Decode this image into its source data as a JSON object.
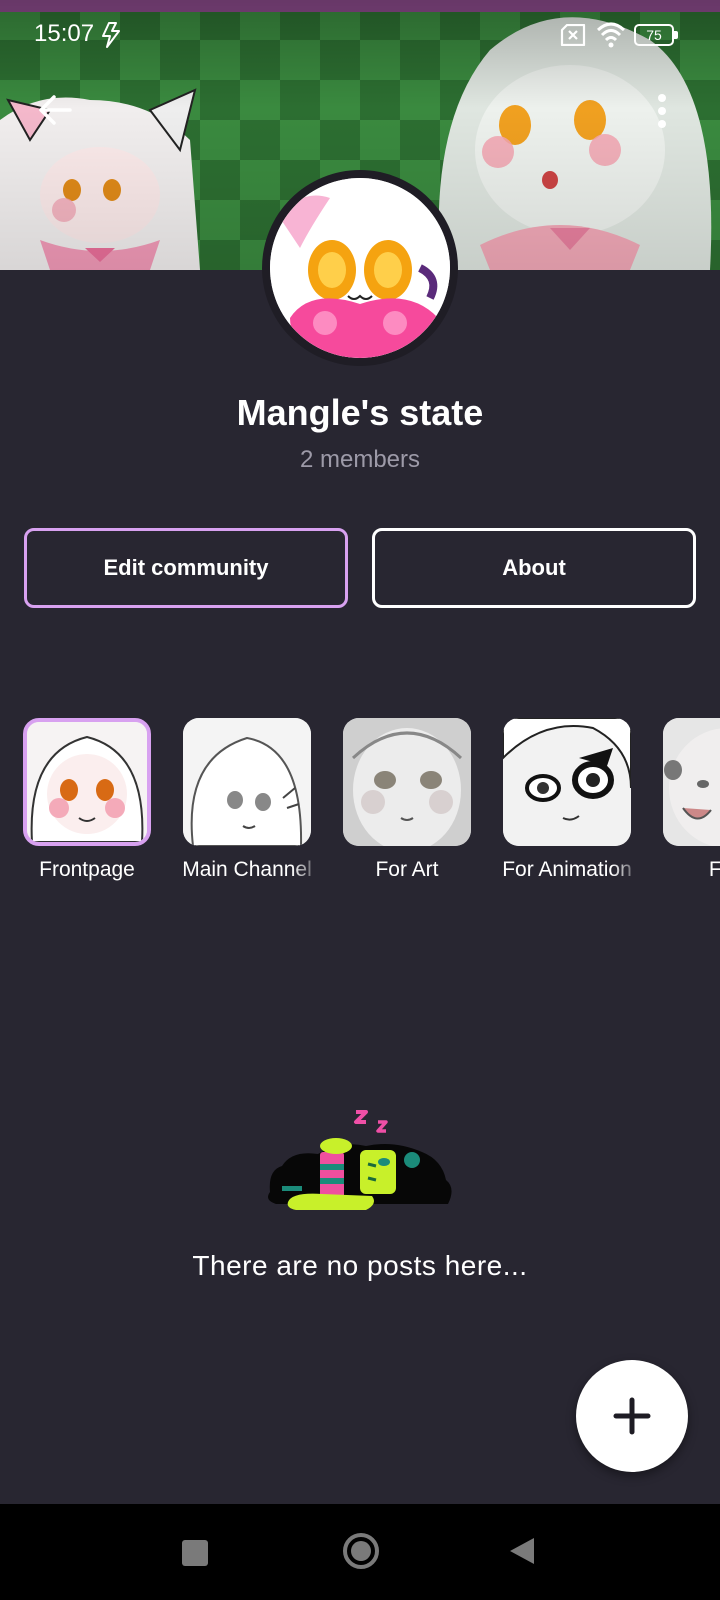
{
  "status_bar": {
    "time": "15:07",
    "battery_level": "75",
    "icons": [
      "charging-bolt-icon",
      "no-sim-icon",
      "wifi-icon",
      "battery-icon"
    ]
  },
  "header": {
    "back_icon": "arrow-left-icon",
    "more_icon": "more-vertical-icon"
  },
  "community": {
    "name": "Mangle's state",
    "members": "2 members"
  },
  "actions": {
    "edit_label": "Edit community",
    "about_label": "About"
  },
  "channels": [
    {
      "label": "Frontpage",
      "selected": true
    },
    {
      "label": "Main Channel",
      "selected": false
    },
    {
      "label": "For Art",
      "selected": false
    },
    {
      "label": "For Animation",
      "selected": false
    },
    {
      "label": "Fun",
      "selected": false
    }
  ],
  "empty_state": {
    "message": "There are no posts here..."
  },
  "fab": {
    "icon": "plus-icon"
  },
  "nav_bar": {
    "icons": [
      "recent-apps-icon",
      "home-icon",
      "back-triangle-icon"
    ]
  },
  "colors": {
    "background": "#282631",
    "accent": "#d8a1f0",
    "muted_text": "#9d9aa8",
    "banner_green": "#3a8a3f"
  }
}
